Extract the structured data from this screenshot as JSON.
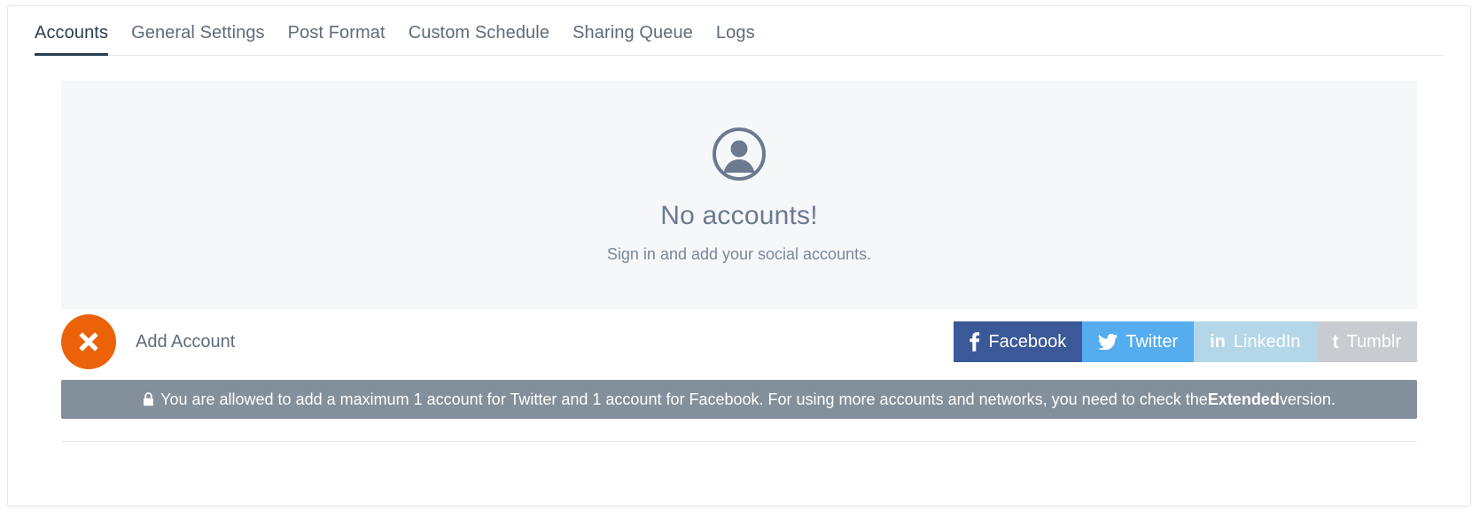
{
  "tabs": [
    {
      "label": "Accounts",
      "active": true
    },
    {
      "label": "General Settings",
      "active": false
    },
    {
      "label": "Post Format",
      "active": false
    },
    {
      "label": "Custom Schedule",
      "active": false
    },
    {
      "label": "Sharing Queue",
      "active": false
    },
    {
      "label": "Logs",
      "active": false
    }
  ],
  "empty_state": {
    "icon": "user-avatar-icon",
    "title": "No accounts!",
    "subtitle": "Sign in and add your social accounts."
  },
  "add_account": {
    "badge_icon": "close-x-icon",
    "badge_color": "#eb6209",
    "label": "Add Account"
  },
  "social_buttons": [
    {
      "label": "Facebook",
      "icon": "facebook-icon",
      "glyph": "f",
      "color": "#3b5998",
      "enabled": true
    },
    {
      "label": "Twitter",
      "icon": "twitter-icon",
      "glyph": "bird",
      "color": "#55acee",
      "enabled": true
    },
    {
      "label": "LinkedIn",
      "icon": "linkedin-icon",
      "glyph": "in",
      "color": "#b3d7e8",
      "enabled": false
    },
    {
      "label": "Tumblr",
      "icon": "tumblr-icon",
      "glyph": "t",
      "color": "#c8ccd1",
      "enabled": false
    }
  ],
  "notice": {
    "icon": "lock-icon",
    "text_before": "You are allowed to add a maximum 1 account for Twitter and 1 account for Facebook. For using more accounts and networks, you need to check the ",
    "emphasis": "Extended",
    "text_after": " version.",
    "background": "#838f9b"
  }
}
